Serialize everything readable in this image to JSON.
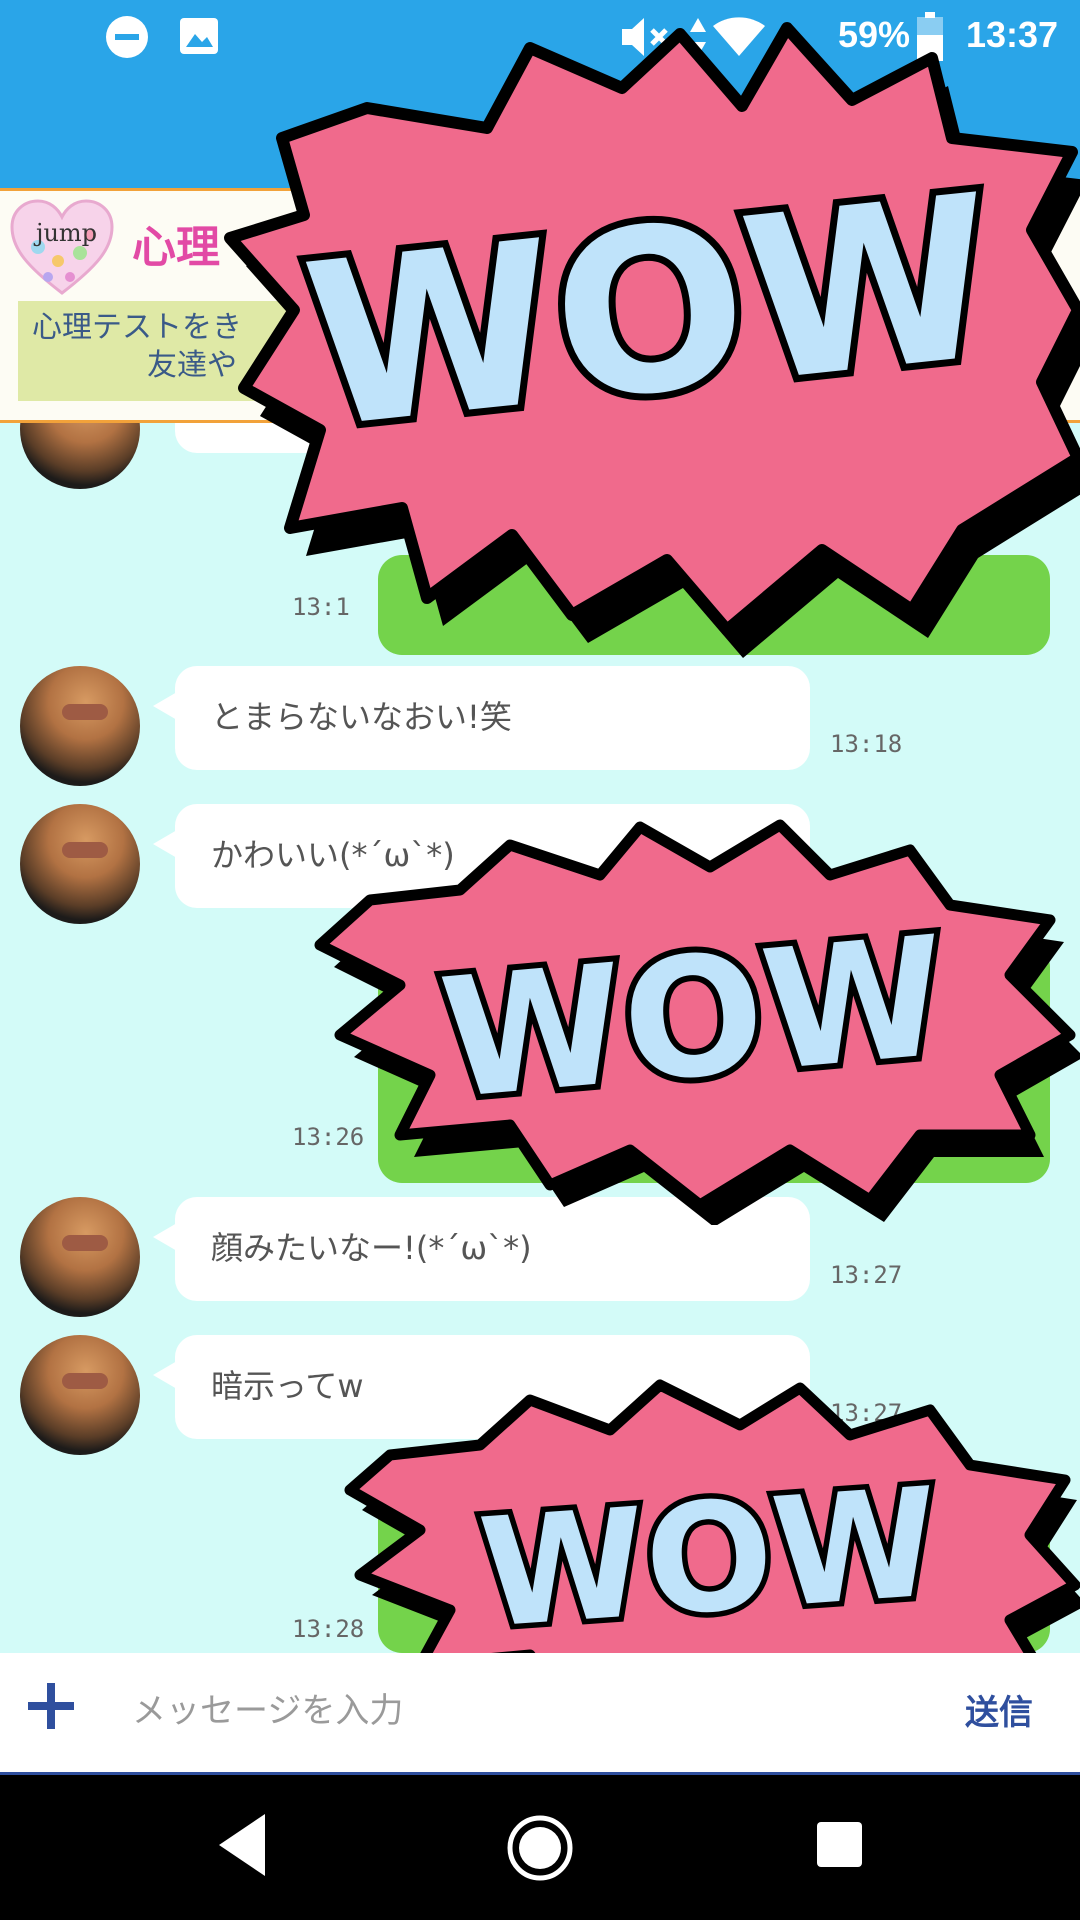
{
  "status_bar": {
    "battery": "59%",
    "time": "13:37"
  },
  "banner": {
    "logo_text": "jump",
    "title": "心理",
    "subtitle_line1": "心理テストをき",
    "subtitle_line2": "友達や"
  },
  "messages": [
    {
      "text": "",
      "time": "13:1"
    },
    {
      "text": "とまらないなおい!笑",
      "time": "13:18"
    },
    {
      "text": "かわいい(*´ω`*)",
      "time": ""
    },
    {
      "text": "",
      "time": "13:26"
    },
    {
      "text": "顔みたいなー!(*´ω`*)",
      "time": "13:27"
    },
    {
      "text": "暗示ってw",
      "time": "13:27"
    },
    {
      "text": "",
      "time": "13:28"
    }
  ],
  "stickers": {
    "text": "WOW"
  },
  "input": {
    "placeholder": "メッセージを入力",
    "send_label": "送信"
  },
  "colors": {
    "header": "#2aa5e8",
    "chat_bg": "#d3fbf8",
    "green_bubble": "#74d34b",
    "sticker_pink": "#f06a8c",
    "sticker_text": "#bfe3fa",
    "accent": "#2f4f9e"
  }
}
